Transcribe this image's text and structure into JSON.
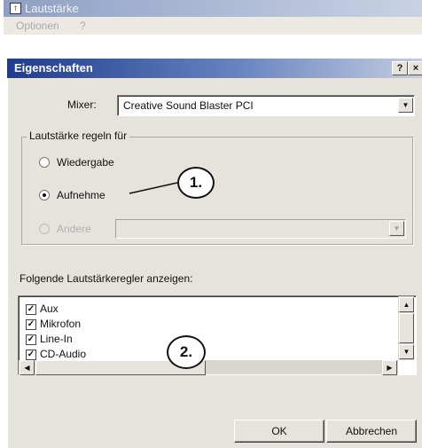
{
  "background_window": {
    "title": "Lautstärke",
    "menu": [
      "Optionen",
      "?"
    ]
  },
  "dialog": {
    "title": "Eigenschaften",
    "help_label": "?",
    "close_label": "×"
  },
  "mixer": {
    "label": "Mixer:",
    "value": "Creative Sound Blaster PCI"
  },
  "volume_group": {
    "label": "Lautstärke regeln für",
    "options": [
      {
        "label": "Wiedergabe",
        "selected": false,
        "enabled": true
      },
      {
        "label": "Aufnehme",
        "selected": true,
        "enabled": true
      },
      {
        "label": "Andere",
        "selected": false,
        "enabled": false
      }
    ]
  },
  "controls_section": {
    "label": "Folgende Lautstärkeregler anzeigen:",
    "items": [
      {
        "label": "Aux",
        "checked": true
      },
      {
        "label": "Mikrofon",
        "checked": true
      },
      {
        "label": "Line-In",
        "checked": true
      },
      {
        "label": "CD-Audio",
        "checked": true
      }
    ]
  },
  "annotations": {
    "callout1": "1.",
    "callout2": "2."
  },
  "buttons": {
    "ok": "OK",
    "cancel": "Abbrechen"
  },
  "icons": {
    "dropdown": "triangle-down",
    "scroll_up": "triangle-up",
    "scroll_down": "triangle-down",
    "scroll_left": "triangle-left",
    "scroll_right": "triangle-right"
  }
}
